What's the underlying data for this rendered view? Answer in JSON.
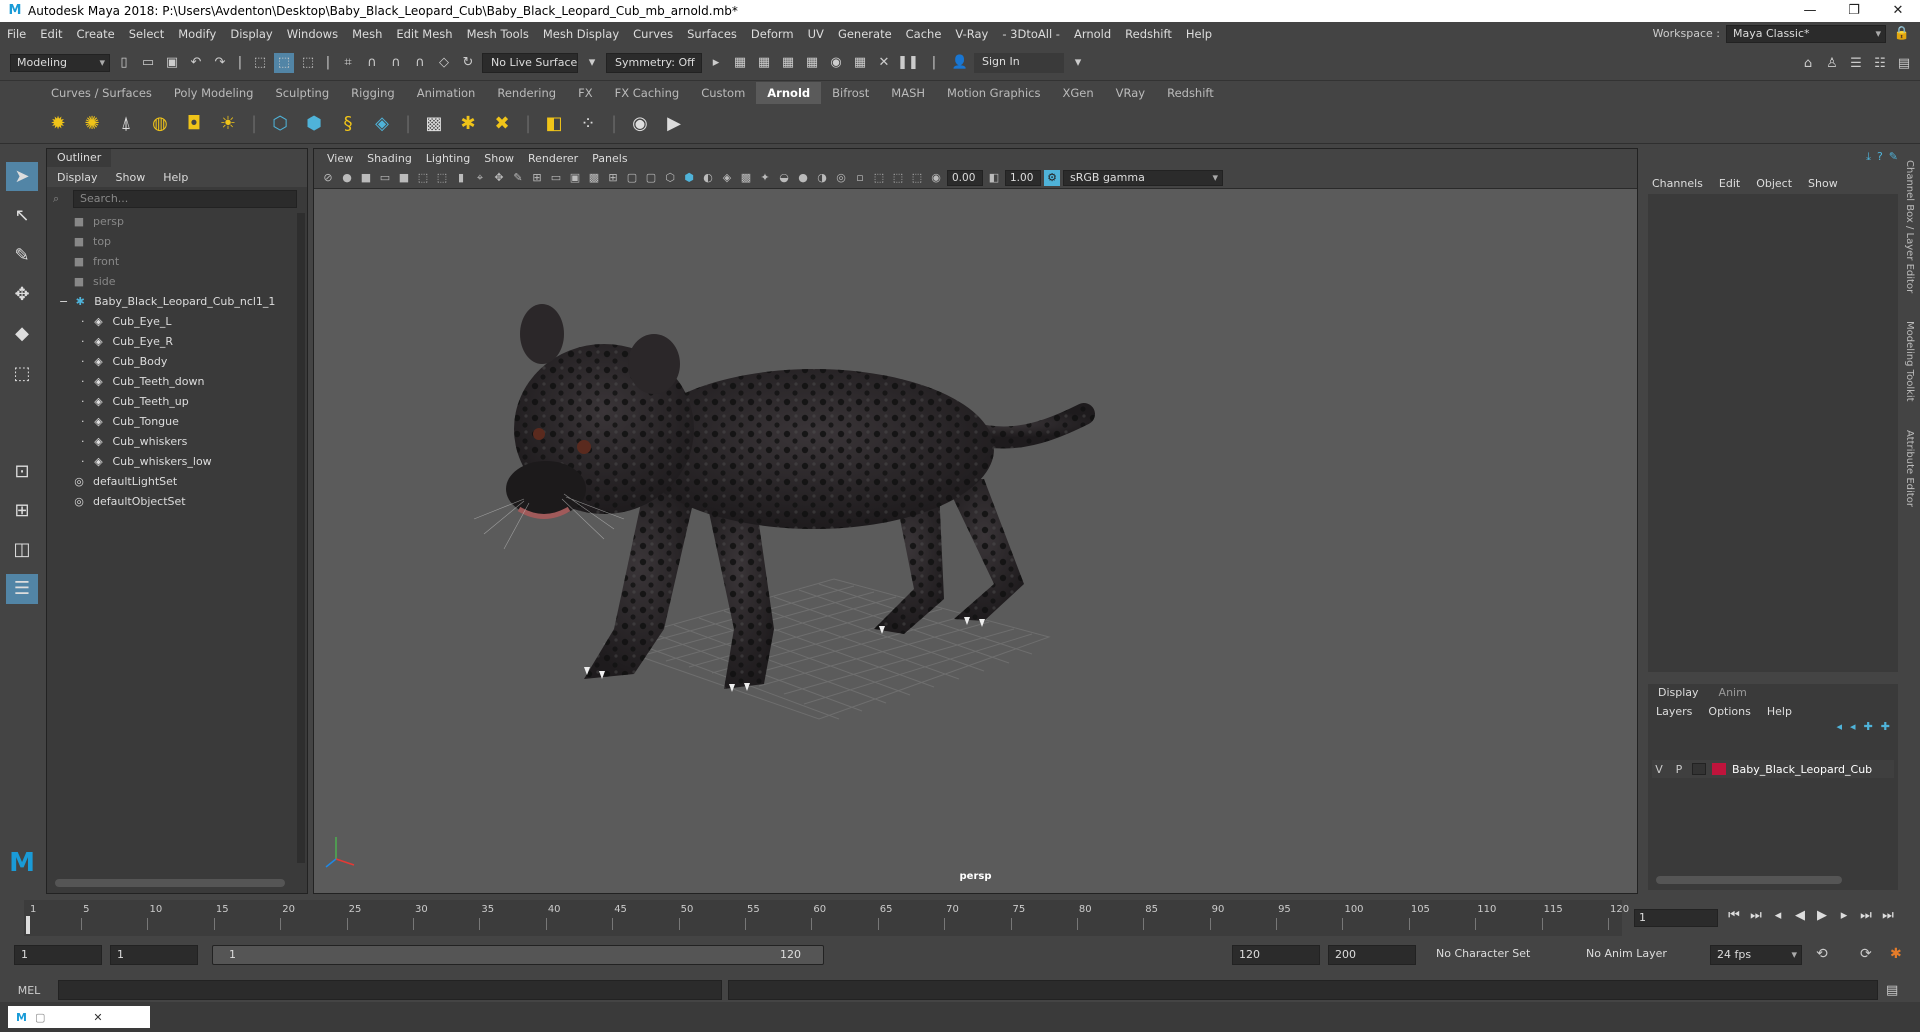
{
  "window": {
    "title": "Autodesk Maya 2018: P:\\Users\\Avdenton\\Desktop\\Baby_Black_Leopard_Cub\\Baby_Black_Leopard_Cub_mb_arnold.mb*",
    "minimize": "—",
    "maximize": "❐",
    "close": "✕"
  },
  "menubar": {
    "items": [
      "File",
      "Edit",
      "Create",
      "Select",
      "Modify",
      "Display",
      "Windows",
      "Mesh",
      "Edit Mesh",
      "Mesh Tools",
      "Mesh Display",
      "Curves",
      "Surfaces",
      "Deform",
      "UV",
      "Generate",
      "Cache",
      "V-Ray",
      "- 3DtoAll -",
      "Arnold",
      "Redshift",
      "Help"
    ],
    "workspace_label": "Workspace :",
    "workspace_value": "Maya Classic*"
  },
  "statusline": {
    "mode": "Modeling",
    "live_surface": "No Live Surface",
    "symmetry": "Symmetry: Off",
    "sign_in": "Sign In"
  },
  "shelf": {
    "tabs": [
      "Curves / Surfaces",
      "Poly Modeling",
      "Sculpting",
      "Rigging",
      "Animation",
      "Rendering",
      "FX",
      "FX Caching",
      "Custom",
      "Arnold",
      "Bifrost",
      "MASH",
      "Motion Graphics",
      "XGen",
      "VRay",
      "Redshift"
    ],
    "active": "Arnold"
  },
  "outliner": {
    "title": "Outliner",
    "menu": [
      "Display",
      "Show",
      "Help"
    ],
    "search_placeholder": "Search...",
    "items": [
      {
        "label": "persp",
        "icon": "camera-icon",
        "indent": 1,
        "dim": true
      },
      {
        "label": "top",
        "icon": "camera-icon",
        "indent": 1,
        "dim": true
      },
      {
        "label": "front",
        "icon": "camera-icon",
        "indent": 1,
        "dim": true
      },
      {
        "label": "side",
        "icon": "camera-icon",
        "indent": 1,
        "dim": true
      },
      {
        "label": "Baby_Black_Leopard_Cub_ncl1_1",
        "icon": "group-icon",
        "indent": 0,
        "expander": "−"
      },
      {
        "label": "Cub_Eye_L",
        "icon": "mesh-icon",
        "indent": 2
      },
      {
        "label": "Cub_Eye_R",
        "icon": "mesh-icon",
        "indent": 2
      },
      {
        "label": "Cub_Body",
        "icon": "mesh-icon",
        "indent": 2
      },
      {
        "label": "Cub_Teeth_down",
        "icon": "mesh-icon",
        "indent": 2
      },
      {
        "label": "Cub_Teeth_up",
        "icon": "mesh-icon",
        "indent": 2
      },
      {
        "label": "Cub_Tongue",
        "icon": "mesh-icon",
        "indent": 2
      },
      {
        "label": "Cub_whiskers",
        "icon": "mesh-icon",
        "indent": 2
      },
      {
        "label": "Cub_whiskers_low",
        "icon": "mesh-icon",
        "indent": 2
      },
      {
        "label": "defaultLightSet",
        "icon": "set-icon",
        "indent": 1
      },
      {
        "label": "defaultObjectSet",
        "icon": "set-icon",
        "indent": 1
      }
    ]
  },
  "viewport": {
    "menu": [
      "View",
      "Shading",
      "Lighting",
      "Show",
      "Renderer",
      "Panels"
    ],
    "exposure": "0.00",
    "gamma": "1.00",
    "colorspace": "sRGB gamma",
    "camera_label": "persp"
  },
  "channelbox": {
    "menu": [
      "Channels",
      "Edit",
      "Object",
      "Show"
    ]
  },
  "layereditor": {
    "tabs": [
      "Display",
      "Anim"
    ],
    "menu": [
      "Layers",
      "Options",
      "Help"
    ],
    "layer": {
      "v": "V",
      "p": "P",
      "name": "Baby_Black_Leopard_Cub",
      "color": "#c0143c"
    }
  },
  "sidetabs": [
    "Channel Box / Layer Editor",
    "Modeling Toolkit",
    "Attribute Editor"
  ],
  "timeline": {
    "ticks": [
      "1",
      "5",
      "10",
      "15",
      "20",
      "25",
      "30",
      "35",
      "40",
      "45",
      "50",
      "55",
      "60",
      "65",
      "70",
      "75",
      "80",
      "85",
      "90",
      "95",
      "100",
      "105",
      "110",
      "115",
      "120"
    ],
    "current_frame": "1"
  },
  "range": {
    "start": "1",
    "playback_start": "1",
    "slider_start": "1",
    "slider_end": "120",
    "playback_end": "120",
    "end": "200",
    "character_set": "No Character Set",
    "anim_layer": "No Anim Layer",
    "fps": "24 fps"
  },
  "cmdline": {
    "label": "MEL"
  },
  "colors": {
    "accent": "#5285a6",
    "maya_blue": "#1a9bd7"
  }
}
